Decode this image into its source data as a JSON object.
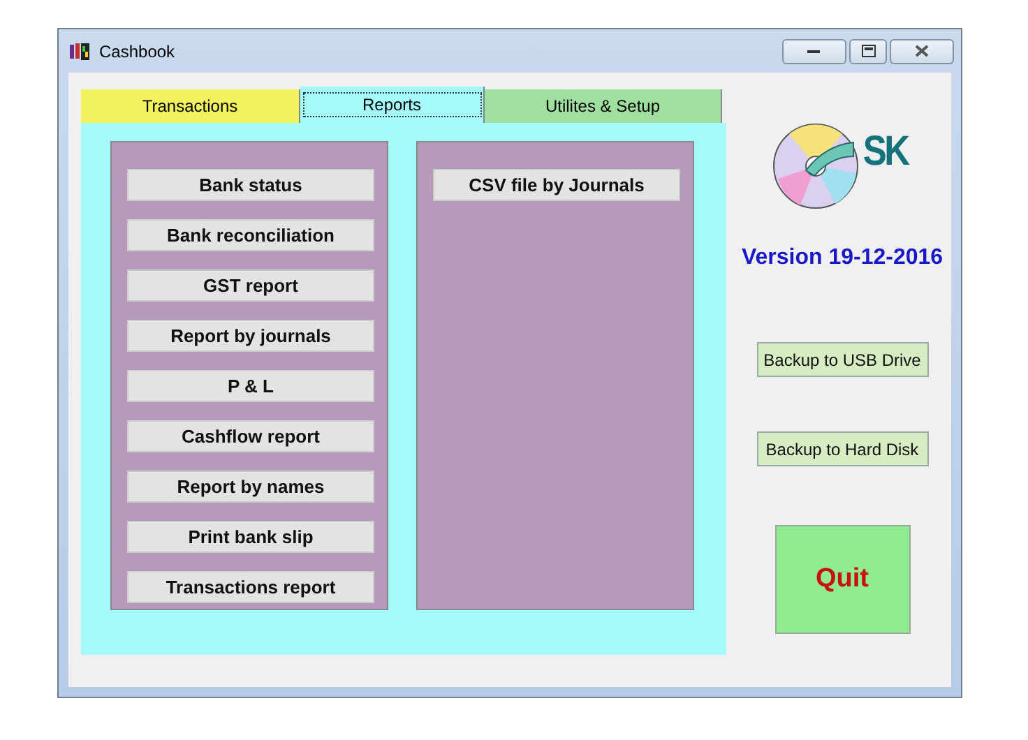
{
  "window": {
    "title": "Cashbook"
  },
  "tabs": [
    {
      "label": "Transactions",
      "selected": false,
      "color": "#f2f25e"
    },
    {
      "label": "Reports",
      "selected": true,
      "color": "#a4fafa"
    },
    {
      "label": "Utilites & Setup",
      "selected": false,
      "color": "#9fdf9f"
    }
  ],
  "reports_left": [
    "Bank status",
    "Bank reconciliation",
    "GST report",
    "Report by journals",
    "P & L",
    "Cashflow report",
    "Report by names",
    "Print bank slip",
    "Transactions report"
  ],
  "reports_right": [
    "CSV file by Journals"
  ],
  "logo": {
    "text": "SK"
  },
  "version": "Version 19-12-2016",
  "backup_buttons": [
    "Backup to USB Drive",
    "Backup to Hard Disk"
  ],
  "quit": "Quit"
}
